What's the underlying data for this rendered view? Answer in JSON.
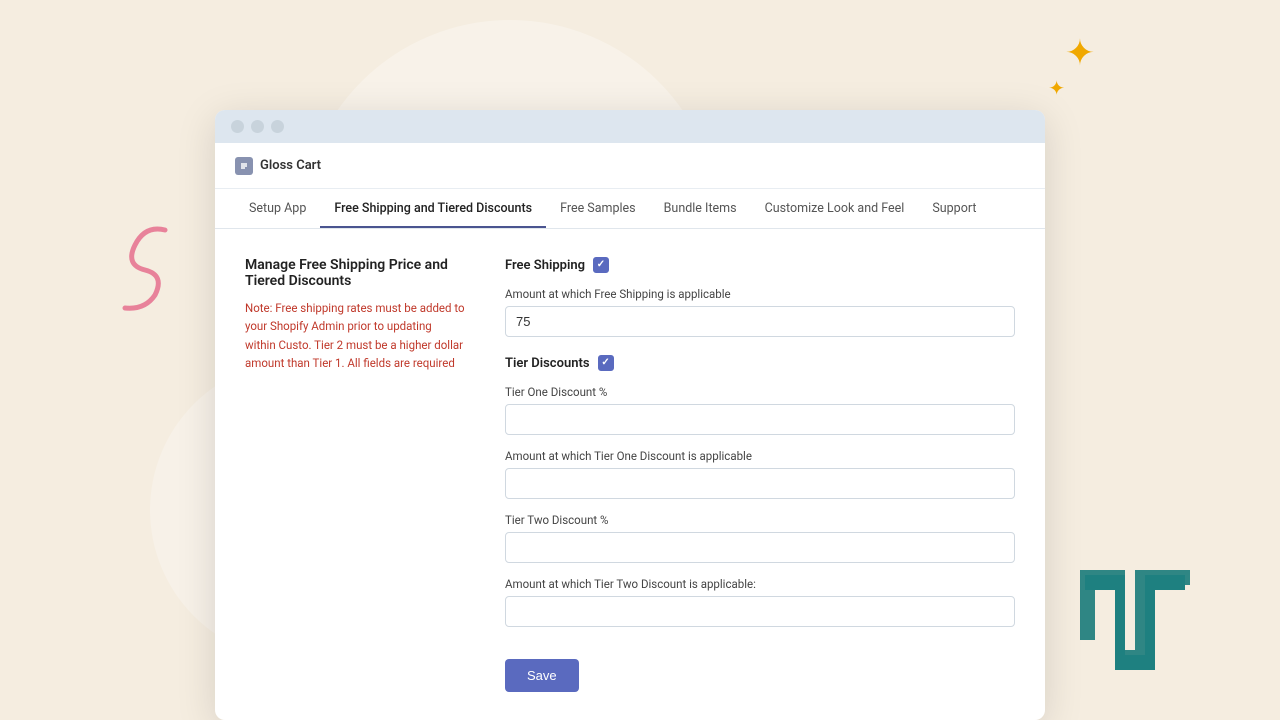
{
  "background": {
    "color": "#f5ede0"
  },
  "decorations": {
    "star_large": "✦",
    "star_small": "✦"
  },
  "browser": {
    "dots": [
      "dot1",
      "dot2",
      "dot3"
    ]
  },
  "app": {
    "logo_label": "Gloss Cart"
  },
  "tabs": [
    {
      "id": "setup",
      "label": "Setup App",
      "active": false
    },
    {
      "id": "free-shipping",
      "label": "Free Shipping and Tiered Discounts",
      "active": true
    },
    {
      "id": "free-samples",
      "label": "Free Samples",
      "active": false
    },
    {
      "id": "bundle-items",
      "label": "Bundle Items",
      "active": false
    },
    {
      "id": "customize",
      "label": "Customize Look and Feel",
      "active": false
    },
    {
      "id": "support",
      "label": "Support",
      "active": false
    }
  ],
  "left_panel": {
    "title": "Manage Free Shipping Price and Tiered Discounts",
    "note": "Note: Free shipping rates must be added to your Shopify Admin prior to updating within Custo. Tier 2 must be a higher dollar amount than Tier 1. All fields are required"
  },
  "right_panel": {
    "free_shipping": {
      "label": "Free Shipping",
      "checked": true,
      "amount_label": "Amount at which Free Shipping is applicable",
      "amount_value": "75"
    },
    "tier_discounts": {
      "label": "Tier Discounts",
      "checked": true,
      "tier_one_discount_label": "Tier One Discount %",
      "tier_one_discount_value": "",
      "tier_one_amount_label": "Amount at which Tier One Discount is applicable",
      "tier_one_amount_value": "",
      "tier_two_discount_label": "Tier Two Discount %",
      "tier_two_discount_value": "",
      "tier_two_amount_label": "Amount at which Tier Two Discount is applicable:",
      "tier_two_amount_value": ""
    },
    "save_button_label": "Save"
  }
}
